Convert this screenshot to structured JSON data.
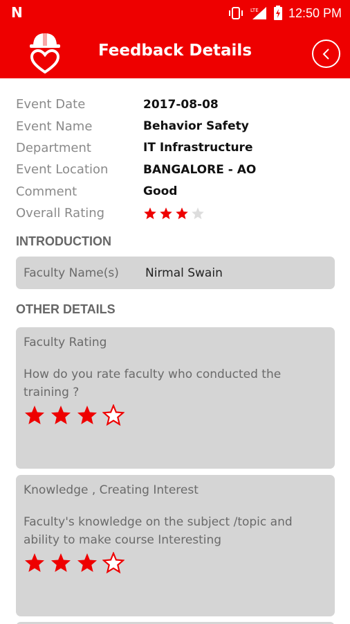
{
  "status_bar": {
    "notification_icon": "N",
    "icons": [
      "vibrate-icon",
      "lte-signal-icon",
      "battery-charging-icon"
    ],
    "lte_label": "LTE",
    "time": "12:50 PM"
  },
  "header": {
    "title": "Feedback Details",
    "logo_icon": "helmet-heart-icon",
    "back_icon": "chevron-left-icon"
  },
  "details": {
    "event_date_label": "Event Date",
    "event_date": "2017-08-08",
    "event_name_label": "Event Name",
    "event_name": "Behavior Safety",
    "department_label": "Department",
    "department": "IT Infrastructure",
    "event_location_label": "Event Location",
    "event_location": "BANGALORE - AO",
    "comment_label": "Comment",
    "comment": "Good",
    "overall_rating_label": "Overall Rating",
    "overall_rating": 3,
    "overall_rating_max": 4
  },
  "introduction": {
    "section_title": "INTRODUCTION",
    "faculty_label": "Faculty Name(s)",
    "faculty_value": "Nirmal Swain"
  },
  "other_details": {
    "section_title": "OTHER DETAILS",
    "questions": [
      {
        "title": "Faculty Rating",
        "text": "How do you rate faculty who conducted the training ?",
        "rating": 3,
        "max": 4
      },
      {
        "title": "Knowledge , Creating Interest",
        "text": "Faculty's knowledge on the subject /topic and ability to make course Interesting",
        "rating": 3,
        "max": 4
      }
    ]
  },
  "colors": {
    "brand_red": "#ee0000",
    "star_red": "#ee0000",
    "star_empty": "#dddddd",
    "card_bg": "#d5d5d5"
  }
}
